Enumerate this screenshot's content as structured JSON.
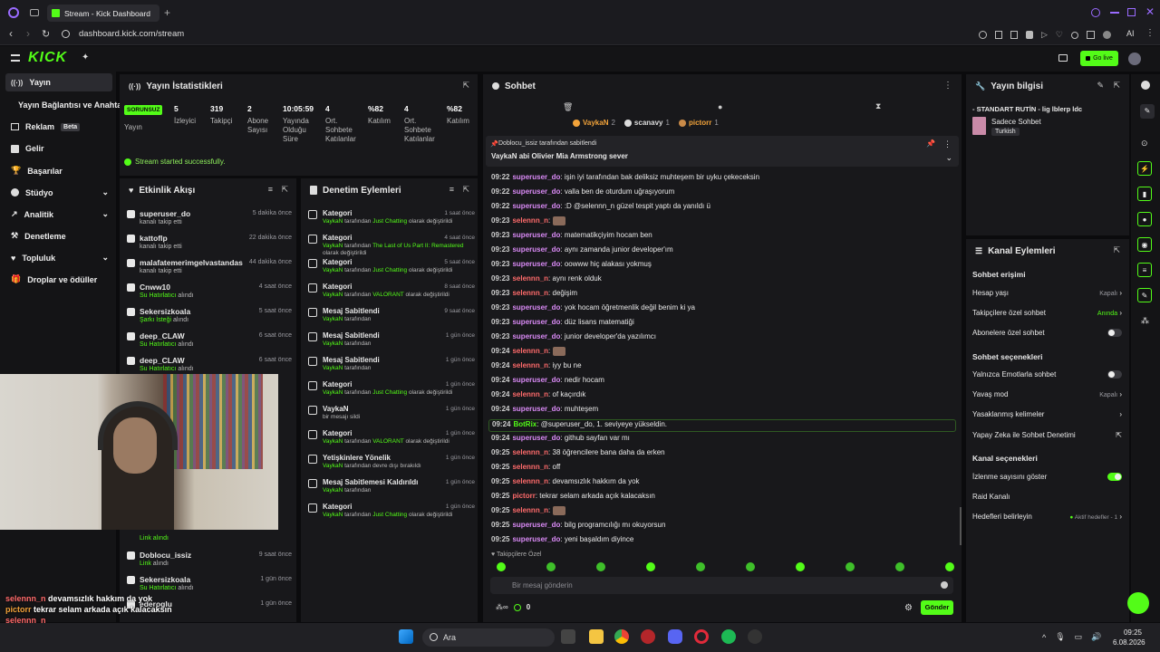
{
  "browser": {
    "tab_title": "Stream - Kick Dashboard",
    "url": "dashboard.kick.com/stream",
    "ai_label": "AI"
  },
  "kick": {
    "logo": "KICK",
    "go_live": "Go live"
  },
  "sidebar": {
    "items": [
      {
        "label": "Yayın",
        "icon": "broadcast-icon"
      },
      {
        "label": "Yayın Bağlantısı ve Anahtarı",
        "icon": "key-icon"
      },
      {
        "label": "Reklam",
        "badge": "Beta",
        "icon": "ad-icon"
      },
      {
        "label": "Gelir",
        "icon": "dollar-icon"
      },
      {
        "label": "Başarılar",
        "icon": "trophy-icon"
      },
      {
        "label": "Stüdyo",
        "icon": "studio-icon"
      },
      {
        "label": "Analitik",
        "icon": "chart-icon"
      },
      {
        "label": "Denetleme",
        "icon": "gavel-icon"
      },
      {
        "label": "Topluluk",
        "icon": "community-icon"
      },
      {
        "label": "Droplar ve ödüller",
        "icon": "gift-icon"
      }
    ]
  },
  "stats": {
    "title": "Yayın İstatistikleri",
    "health_badge": "SORUNSUZ",
    "health_label": "Yayın",
    "items": [
      {
        "value": "5",
        "label": "İzleyici"
      },
      {
        "value": "319",
        "label": "Takipçi"
      },
      {
        "value": "2",
        "label": "Abone Sayısı"
      },
      {
        "value": "10:05:59",
        "label": "Yayında Olduğu Süre"
      },
      {
        "value": "4",
        "label": "Ort. Sohbete Katılanlar"
      },
      {
        "value": "%82",
        "label": "Katılım"
      },
      {
        "value": "4",
        "label": "Ort. Sohbete Katılanlar"
      },
      {
        "value": "%82",
        "label": "Katılım"
      }
    ],
    "success": "Stream started successfully."
  },
  "activity": {
    "title": "Etkinlik Akışı",
    "items": [
      {
        "name": "superuser_do",
        "sub": "kanalı takip etti",
        "time": "5 dakika önce"
      },
      {
        "name": "kattoflp",
        "sub": "kanalı takip etti",
        "time": "22 dakika önce"
      },
      {
        "name": "malafatemerimgelvastandas",
        "sub": "kanalı takip etti",
        "time": "44 dakika önce"
      },
      {
        "name": "Cnww10",
        "sub_hl": "Su Hatırlatıcı",
        "sub": "alındı",
        "time": "4 saat önce"
      },
      {
        "name": "Sekersizkoala",
        "sub_hl": "Şarkı İsteği",
        "sub": "alındı",
        "time": "5 saat önce"
      },
      {
        "name": "deep_CLAW",
        "sub_hl": "Su Hatırlatıcı",
        "sub": "alındı",
        "time": "6 saat önce"
      },
      {
        "name": "deep_CLAW",
        "sub_hl": "Su Hatırlatıcı",
        "sub": "alındı",
        "time": "6 saat önce"
      },
      {
        "name": "Doblocu_issiz",
        "sub_hl": "Link",
        "sub": "alındı",
        "time": "9 saat önce"
      },
      {
        "name": "Sekersizkoala",
        "sub_hl": "Su Hatırlatıcı",
        "sub": "alındı",
        "time": "1 gün önce"
      },
      {
        "name": "ederoglu",
        "sub": "",
        "time": "1 gün önce"
      }
    ],
    "partial_sub": "Link alındı"
  },
  "moderation": {
    "title": "Denetim Eylemleri",
    "items": [
      {
        "name": "Kategori",
        "user": "VaykaN",
        "mid": "tarafından",
        "hl": "Just Chatting",
        "end": "olarak değiştirildi",
        "time": "1 saat önce"
      },
      {
        "name": "Kategori",
        "user": "VaykaN",
        "mid": "tarafından",
        "hl": "The Last of Us Part II: Remastered",
        "end": "olarak değiştirildi",
        "time": "4 saat önce"
      },
      {
        "name": "Kategori",
        "user": "VaykaN",
        "mid": "tarafından",
        "hl": "Just Chatting",
        "end": "olarak değiştirildi",
        "time": "5 saat önce"
      },
      {
        "name": "Kategori",
        "user": "VaykaN",
        "mid": "tarafından",
        "hl": "VALORANT",
        "end": "olarak değiştirildi",
        "time": "8 saat önce"
      },
      {
        "name": "Mesaj Sabitlendi",
        "user": "VaykaN",
        "mid": "tarafından",
        "hl": "",
        "end": "",
        "time": "9 saat önce"
      },
      {
        "name": "Mesaj Sabitlendi",
        "user": "VaykaN",
        "mid": "tarafından",
        "hl": "",
        "end": "",
        "time": "1 gün önce"
      },
      {
        "name": "Mesaj Sabitlendi",
        "user": "VaykaN",
        "mid": "tarafından",
        "hl": "",
        "end": "",
        "time": "1 gün önce"
      },
      {
        "name": "Kategori",
        "user": "VaykaN",
        "mid": "tarafından",
        "hl": "Just Chatting",
        "end": "olarak değiştirildi",
        "time": "1 gün önce"
      },
      {
        "name": "VaykaN",
        "user": "",
        "mid": "bir mesajı sildi",
        "hl": "",
        "end": "",
        "time": "1 gün önce"
      },
      {
        "name": "Kategori",
        "user": "VaykaN",
        "mid": "tarafından",
        "hl": "VALORANT",
        "end": "olarak değiştirildi",
        "time": "1 gün önce"
      },
      {
        "name": "Yetişkinlere Yönelik",
        "user": "VaykaN",
        "mid": "tarafından devre dışı bırakıldı",
        "hl": "",
        "end": "",
        "time": "1 gün önce"
      },
      {
        "name": "Mesaj Sabitlemesi Kaldırıldı",
        "user": "VaykaN",
        "mid": "tarafından",
        "hl": "",
        "end": "",
        "time": "1 gün önce"
      },
      {
        "name": "Kategori",
        "user": "VaykaN",
        "mid": "tarafından",
        "hl": "Just Chatting",
        "end": "olarak değiştirildi",
        "time": "1 gün önce"
      }
    ]
  },
  "chat": {
    "title": "Sohbet",
    "top_users": [
      {
        "name": "VaykaN",
        "count": "2",
        "color": "#f2a33a"
      },
      {
        "name": "scanavy",
        "count": "1",
        "color": "#dddddd"
      },
      {
        "name": "pictorr",
        "count": "1",
        "color": "#f2a33a"
      }
    ],
    "pinned_by": "Doblocu_issiz tarafından sabitlendi",
    "pinned_msg": "VaykaN abi Olivier Mia Armstrong sever",
    "messages": [
      {
        "t": "09:22",
        "u": "superuser_do",
        "c": "#d98af5",
        "m": "işin iyi tarafından bak deliksiz muhteşem bir uyku çekeceksin"
      },
      {
        "t": "09:22",
        "u": "superuser_do",
        "c": "#d98af5",
        "m": "valla ben de oturdum uğraşıyorum"
      },
      {
        "t": "09:22",
        "u": "superuser_do",
        "c": "#d98af5",
        "m": ":D @selennn_n güzel tespit yaptı da yanıldı ü"
      },
      {
        "t": "09:23",
        "u": "selennn_n",
        "c": "#ff6b6b",
        "m": ""
      },
      {
        "t": "09:23",
        "u": "superuser_do",
        "c": "#d98af5",
        "m": "matematikçiyim hocam ben"
      },
      {
        "t": "09:23",
        "u": "superuser_do",
        "c": "#d98af5",
        "m": "aynı zamanda junior developer'ım"
      },
      {
        "t": "09:23",
        "u": "superuser_do",
        "c": "#d98af5",
        "m": "oowww hiç alakası yokmuş"
      },
      {
        "t": "09:23",
        "u": "selennn_n",
        "c": "#ff6b6b",
        "m": "aynı renk olduk"
      },
      {
        "t": "09:23",
        "u": "selennn_n",
        "c": "#ff6b6b",
        "m": "değişim"
      },
      {
        "t": "09:23",
        "u": "superuser_do",
        "c": "#d98af5",
        "m": "yok hocam öğretmenlik değil benim ki ya"
      },
      {
        "t": "09:23",
        "u": "superuser_do",
        "c": "#d98af5",
        "m": "düz lisans matematiği"
      },
      {
        "t": "09:23",
        "u": "superuser_do",
        "c": "#d98af5",
        "m": "junior developer'da yazılımcı"
      },
      {
        "t": "09:24",
        "u": "selennn_n",
        "c": "#ff6b6b",
        "m": ""
      },
      {
        "t": "09:24",
        "u": "selennn_n",
        "c": "#ff6b6b",
        "m": "iyy bu ne"
      },
      {
        "t": "09:24",
        "u": "superuser_do",
        "c": "#d98af5",
        "m": "nedir hocam"
      },
      {
        "t": "09:24",
        "u": "selennn_n",
        "c": "#ff6b6b",
        "m": "of kaçırdık"
      },
      {
        "t": "09:24",
        "u": "superuser_do",
        "c": "#d98af5",
        "m": "muhteşem"
      },
      {
        "t": "09:24",
        "u": "BotRix",
        "c": "#53fc18",
        "m": "@superuser_do, 1. seviyeye yükseldin."
      },
      {
        "t": "09:24",
        "u": "superuser_do",
        "c": "#d98af5",
        "m": "github sayfan var mı"
      },
      {
        "t": "09:25",
        "u": "selennn_n",
        "c": "#ff6b6b",
        "m": "38 öğrencilere bana daha da erken"
      },
      {
        "t": "09:25",
        "u": "selennn_n",
        "c": "#ff6b6b",
        "m": "off"
      },
      {
        "t": "09:25",
        "u": "selennn_n",
        "c": "#ff6b6b",
        "m": "devamsızlık hakkım da yok"
      },
      {
        "t": "09:25",
        "u": "pictorr",
        "c": "#ff6b6b",
        "m": "tekrar selam arkada açık kalacaksın"
      },
      {
        "t": "09:25",
        "u": "selennn_n",
        "c": "#ff6b6b",
        "m": ""
      },
      {
        "t": "09:25",
        "u": "superuser_do",
        "c": "#d98af5",
        "m": "bilg programcılığı mı okuyorsun"
      },
      {
        "t": "09:25",
        "u": "superuser_do",
        "c": "#d98af5",
        "m": "yeni başaldım diyince"
      }
    ],
    "followers_only": "Takipçilere Özel",
    "input_placeholder": "Bir mesaj gönderin",
    "points": "0",
    "send": "Gönder"
  },
  "stream_info": {
    "title": "Yayın bilgisi",
    "stream_title": "- STANDART RUTİN - lig lblerp ldc",
    "category": "Sadece Sohbet",
    "language": "Turkish"
  },
  "channel_actions": {
    "title": "Kanal Eylemleri",
    "chat_access": "Sohbet erişimi",
    "account_age": "Hesap yaşı",
    "account_age_val": "Kapalı",
    "followers_only": "Takipçilere özel sohbet",
    "followers_only_val": "Anında",
    "subs_only": "Abonelere özel sohbet",
    "chat_options": "Sohbet seçenekleri",
    "emotes_only": "Yalnızca Emotlarla sohbet",
    "slow_mode": "Yavaş mod",
    "slow_mode_val": "Kapalı",
    "banned_words": "Yasaklanmış kelimeler",
    "ai_moderation": "Yapay Zeka ile Sohbet Denetimi",
    "channel_options": "Kanal seçenekleri",
    "show_viewers": "İzlenme sayısını göster",
    "raid": "Raid Kanalı",
    "targets": "Hedefleri belirleyin",
    "targets_val": "Aktif hedefler - 1"
  },
  "overlay": [
    {
      "u": "selennn_n",
      "c": "#ff6b6b",
      "m": "devamsızlık hakkım da yok"
    },
    {
      "u": "pictorr",
      "c": "#f2a33a",
      "m": "tekrar selam arkada açık kalacaksın"
    },
    {
      "u": "selennn_n",
      "c": "#ff6b6b",
      "m": ""
    },
    {
      "u": "superuser_do",
      "c": "#d98af5",
      "m": "bilg programcılığı mı okuyorsun"
    },
    {
      "u": "superuser_do",
      "c": "#d98af5",
      "m": "yeni başaldım diyince"
    }
  ],
  "taskbar": {
    "search": "Ara",
    "time": "09:25",
    "date": "6.08.2026"
  }
}
